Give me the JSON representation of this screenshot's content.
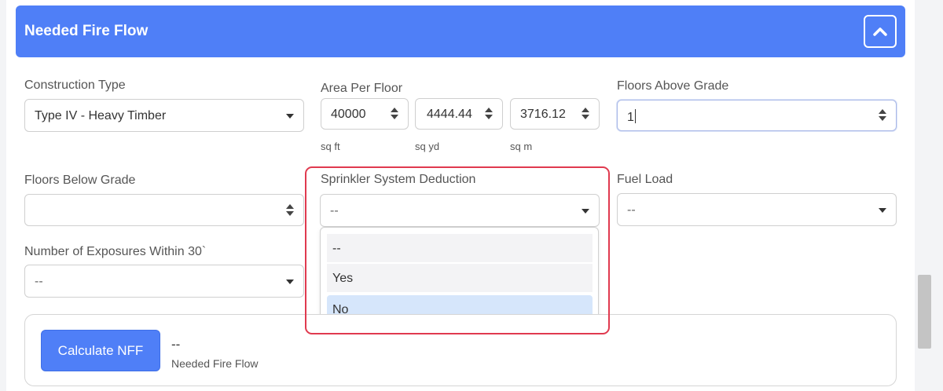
{
  "header": {
    "title": "Needed Fire Flow"
  },
  "construction_type": {
    "label": "Construction Type",
    "value": "Type IV - Heavy Timber"
  },
  "area_per_floor": {
    "label": "Area Per Floor",
    "sq_ft": {
      "value": "40000",
      "unit": "sq ft"
    },
    "sq_yd": {
      "value": "4444.44",
      "unit": "sq yd"
    },
    "sq_m": {
      "value": "3716.12",
      "unit": "sq m"
    }
  },
  "floors_above_grade": {
    "label": "Floors Above Grade",
    "value": "1"
  },
  "floors_below_grade": {
    "label": "Floors Below Grade",
    "value": ""
  },
  "sprinkler": {
    "label": "Sprinkler System Deduction",
    "value": "--",
    "options": [
      "--",
      "Yes",
      "No"
    ]
  },
  "fuel_load": {
    "label": "Fuel Load",
    "value": "--"
  },
  "exposures": {
    "label": "Number of Exposures Within 30`",
    "value": "--"
  },
  "result": {
    "button_label": "Calculate NFF",
    "value": "--",
    "label": "Needed Fire Flow"
  },
  "colors": {
    "accent": "#4f7ff7",
    "highlight": "#e03a4f",
    "selected_option": "#d6e6fb"
  }
}
